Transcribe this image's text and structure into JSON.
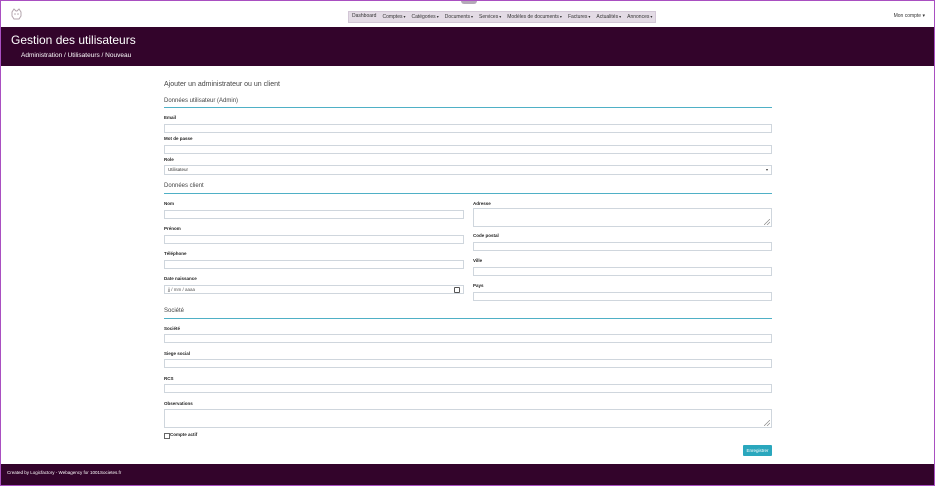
{
  "nav": {
    "items": [
      {
        "label": "Dashboard",
        "caret": ""
      },
      {
        "label": "Comptes",
        "caret": "▾"
      },
      {
        "label": "Catégories",
        "caret": "▾"
      },
      {
        "label": "Documents",
        "caret": "▾"
      },
      {
        "label": "Services",
        "caret": "▾"
      },
      {
        "label": "Modèles de documents",
        "caret": "▾"
      },
      {
        "label": "Factures",
        "caret": "▾"
      },
      {
        "label": "Actualités",
        "caret": "▾"
      },
      {
        "label": "Annonces",
        "caret": "▾"
      }
    ],
    "account": "Mon compte ▾"
  },
  "header": {
    "title": "Gestion des utilisateurs",
    "breadcrumb": "Administration / Utilisateurs / Nouveau"
  },
  "form": {
    "heading": "Ajouter un administrateur ou un client",
    "section_user": "Données utilisateur (Admin)",
    "email_label": "Email",
    "password_label": "Mot de passe",
    "role_label": "Role",
    "role_value": "Utilisateur",
    "section_client": "Données client",
    "nom_label": "Nom",
    "prenom_label": "Prénom",
    "telephone_label": "Téléphone",
    "date_label": "Date naissance",
    "date_placeholder": "jj / mm / aaaa",
    "adresse_label": "Adresse",
    "cp_label": "Code postal",
    "ville_label": "Ville",
    "pays_label": "Pays",
    "section_company": "Société",
    "societe_label": "Société",
    "siege_label": "Siege social",
    "rcs_label": "RCS",
    "observations_label": "Observations",
    "active_label": "Compte actif",
    "save_label": "Enregistrer"
  },
  "footer": {
    "text": "Created by Logicfactory - Webagency for 1001Societes.fr"
  }
}
